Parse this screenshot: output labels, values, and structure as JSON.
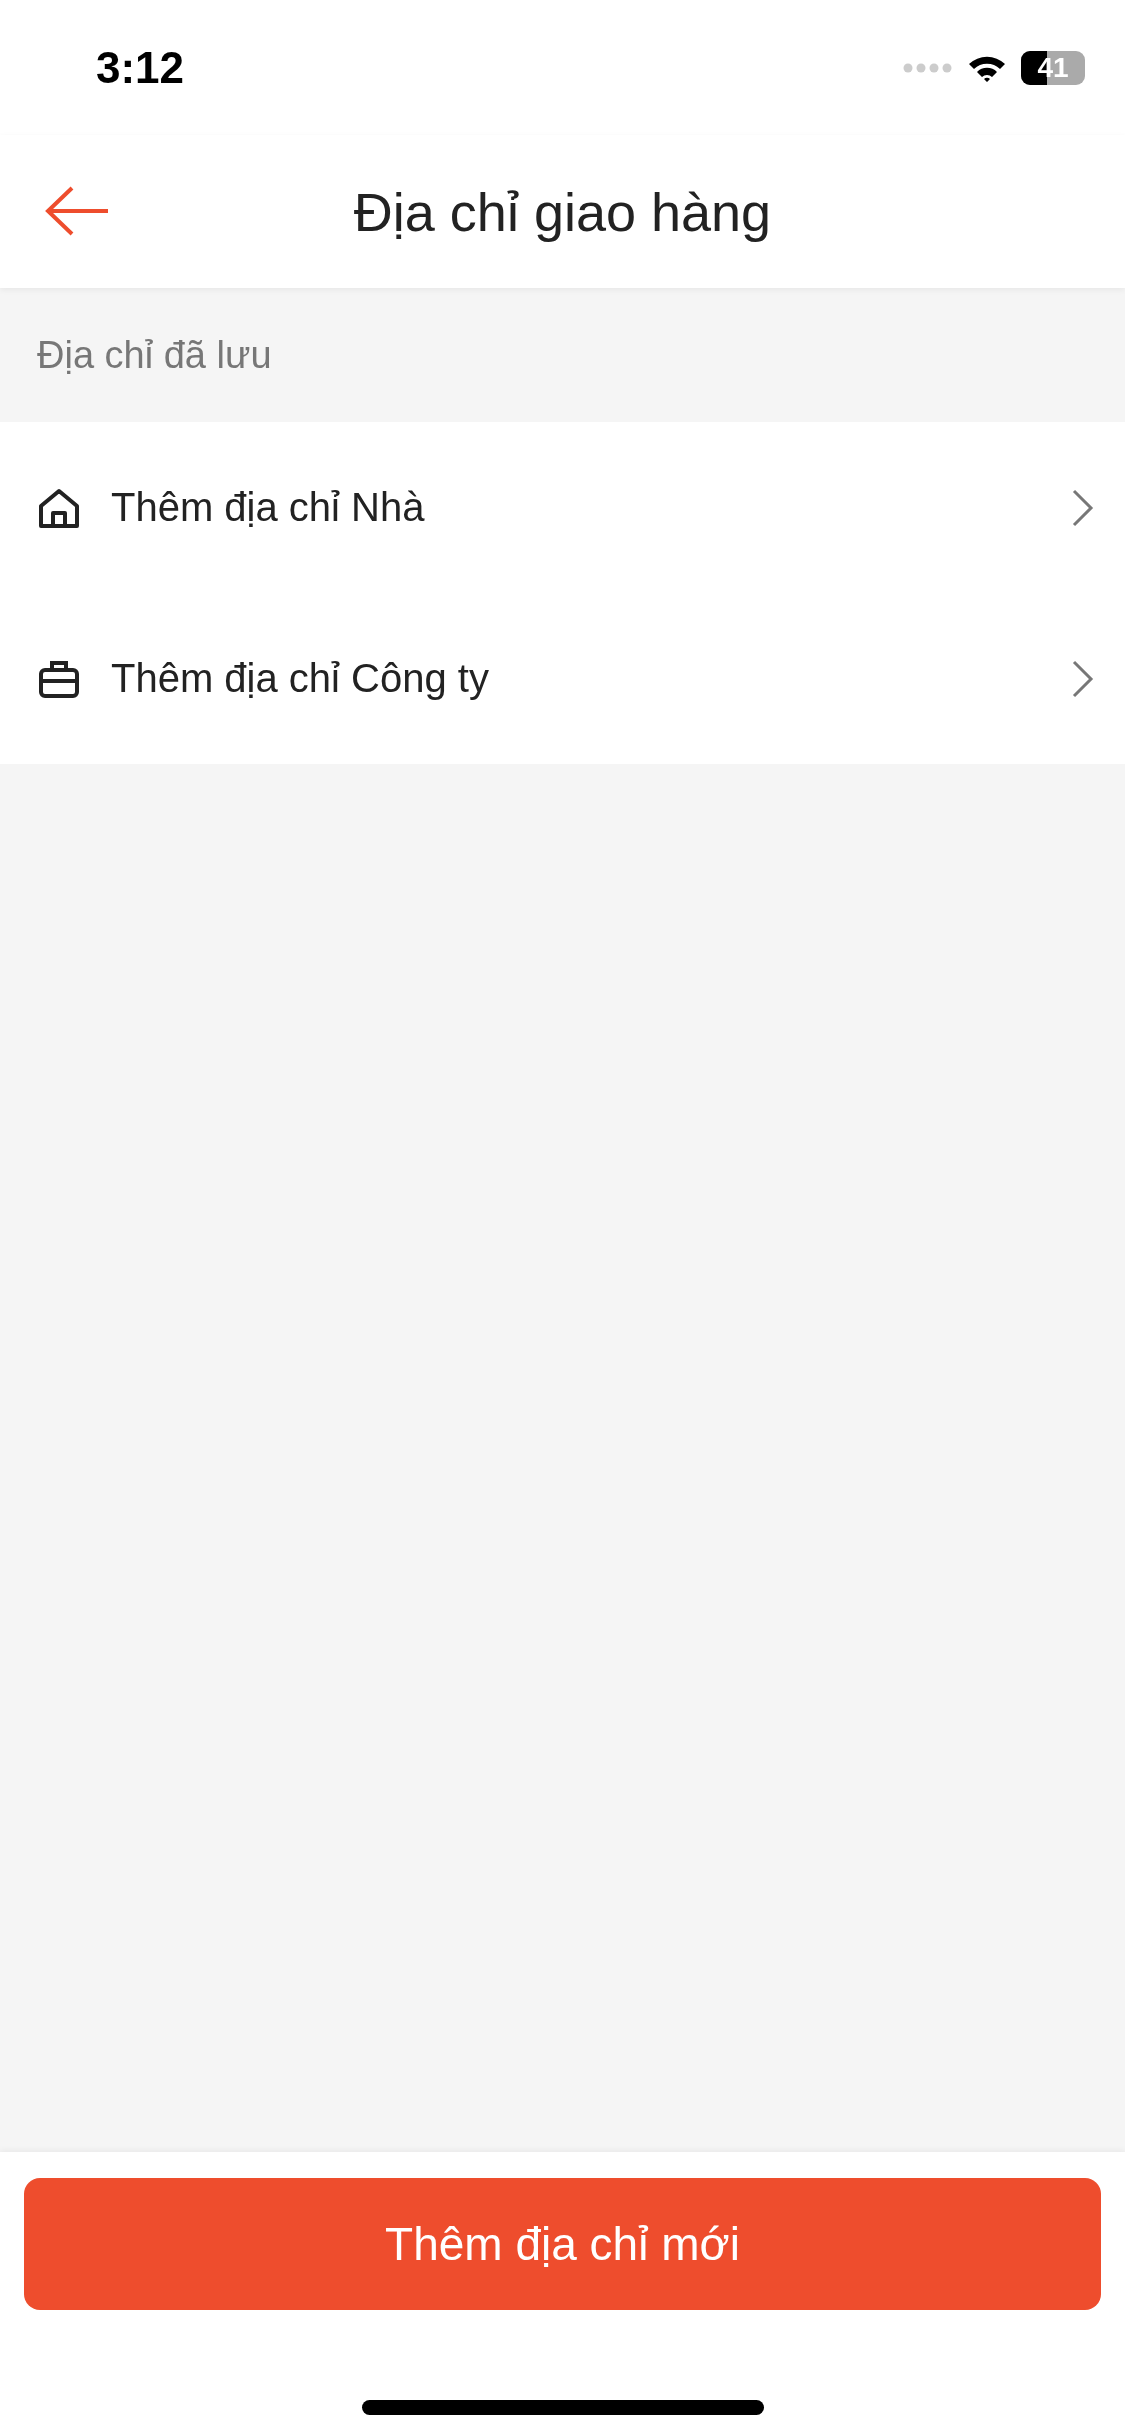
{
  "status_bar": {
    "time": "3:12",
    "battery": "41"
  },
  "header": {
    "title": "Địa chỉ giao hàng"
  },
  "section": {
    "label": "Địa chỉ đã lưu"
  },
  "addresses": [
    {
      "kind": "home",
      "label": "Thêm địa chỉ Nhà"
    },
    {
      "kind": "work",
      "label": "Thêm địa chỉ Công ty"
    }
  ],
  "footer": {
    "button": "Thêm địa chỉ mới"
  }
}
